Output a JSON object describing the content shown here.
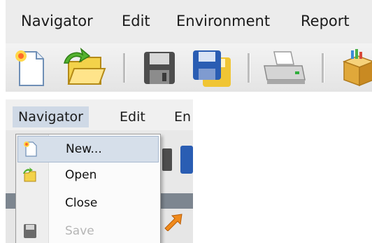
{
  "top": {
    "menu": [
      {
        "label": "Navigator"
      },
      {
        "label": "Edit"
      },
      {
        "label": "Environment"
      },
      {
        "label": "Report"
      }
    ],
    "toolbar": {
      "buttons": [
        {
          "name": "new",
          "icon": "new-document-icon"
        },
        {
          "name": "open",
          "icon": "open-folder-icon"
        },
        {
          "name": "save",
          "icon": "save-disk-icon"
        },
        {
          "name": "save-all",
          "icon": "save-all-disks-icon"
        },
        {
          "name": "print",
          "icon": "printer-icon"
        },
        {
          "name": "package",
          "icon": "package-icon"
        }
      ]
    }
  },
  "bottom": {
    "menu": [
      {
        "label": "Navigator"
      },
      {
        "label": "Edit"
      },
      {
        "label": "En"
      }
    ],
    "dropdown": {
      "items": [
        {
          "label": "New...",
          "icon": "new-document-icon",
          "highlighted": true,
          "enabled": true
        },
        {
          "label": "Open",
          "icon": "open-folder-icon",
          "highlighted": false,
          "enabled": true
        },
        {
          "label": "Close",
          "icon": "",
          "highlighted": false,
          "enabled": true
        },
        {
          "label": "Save",
          "icon": "save-disk-icon",
          "highlighted": false,
          "enabled": false
        }
      ]
    }
  },
  "colors": {
    "menu_bg": "#ececec",
    "highlight": "#d6dfea",
    "disabled_text": "#b5b5b5"
  }
}
